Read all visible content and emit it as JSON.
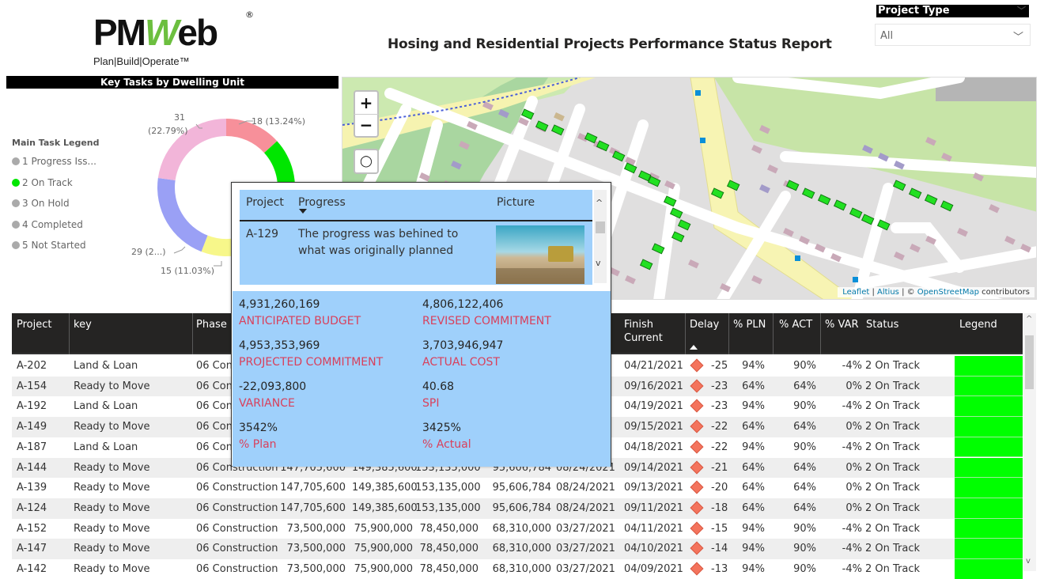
{
  "brand": {
    "logo_text_a": "PM",
    "logo_text_w": "W",
    "logo_text_b": "eb",
    "registered": "®",
    "tagline": "Plan|Build|Operate™"
  },
  "report_title": "Hosing and Residential Projects Performance Status Report",
  "slicer": {
    "label": "Project Type",
    "value": "All",
    "chevron": "chevron-down-icon"
  },
  "donut_panel": {
    "title": "Key Tasks by Dwelling Unit",
    "legend_title": "Main Task Legend",
    "legend": [
      {
        "label": "1 Progress Iss...",
        "color": "#aaaaaa"
      },
      {
        "label": "2 On Track",
        "color": "#00e600"
      },
      {
        "label": "3 On Hold",
        "color": "#aaaaaa"
      },
      {
        "label": "4 Completed",
        "color": "#aaaaaa"
      },
      {
        "label": "5 Not Started",
        "color": "#aaaaaa"
      }
    ]
  },
  "chart_data": {
    "type": "pie",
    "title": "Key Tasks by Dwelling Unit",
    "donut": true,
    "categories": [
      "1 Progress Issues",
      "2 On Track",
      "3 On Hold",
      "4 Completed",
      "5 Not Started"
    ],
    "values": [
      18,
      43,
      15,
      29,
      31
    ],
    "colors": [
      "#f7909a",
      "#00e600",
      "#f7f78a",
      "#9aa0f5",
      "#f2b5d9"
    ],
    "data_labels": [
      "18 (13.24%)",
      "",
      "15 (11.03%)",
      "29 (2...)",
      "31 (22.79%)"
    ],
    "legend_position": "left"
  },
  "map": {
    "zoom_in": "+",
    "zoom_out": "−",
    "lasso_icon": "lasso-icon",
    "attribution": {
      "leaflet": "Leaflet",
      "sep1": " | ",
      "altius": "Altius",
      "sep2": " | © ",
      "osm": "OpenStreetMap",
      "tail": " contributors"
    }
  },
  "tooltip": {
    "columns": [
      "Project",
      "Progress",
      "Picture"
    ],
    "row": {
      "project": "A-129",
      "progress": "The progress was behined to what was originally planned"
    },
    "kpis": [
      {
        "value": "4,931,260,169",
        "label": "ANTICIPATED BUDGET"
      },
      {
        "value": "4,806,122,406",
        "label": "REVISED COMMITMENT"
      },
      {
        "value": "4,953,353,969",
        "label": "PROJECTED COMMITMENT"
      },
      {
        "value": "3,703,946,947",
        "label": "ACTUAL COST"
      },
      {
        "value": "-22,093,800",
        "label": "VARIANCE"
      },
      {
        "value": "40.68",
        "label": "SPI"
      },
      {
        "value": "3542%",
        "label": "% Plan"
      },
      {
        "value": "3425%",
        "label": "% Actual"
      }
    ]
  },
  "table": {
    "columns": [
      "Project",
      "key",
      "Phase",
      "Finish\nCurrent",
      "Delay",
      "% PLN",
      "% ACT",
      "% VAR",
      "Status",
      "Legend"
    ],
    "finish_col": [
      "Finish",
      "Current"
    ],
    "rows": [
      {
        "project": "A-202",
        "key": "Land & Loan",
        "phase": "06 Con",
        "c1": "",
        "c2": "",
        "c3": "",
        "c4": "",
        "start": "",
        "finish": "04/21/2021",
        "delay": "-25",
        "pln": "94%",
        "act": "90%",
        "var": "-4%",
        "status": "2 On Track"
      },
      {
        "project": "A-154",
        "key": "Ready to Move",
        "phase": "06 Con",
        "c1": "",
        "c2": "",
        "c3": "",
        "c4": "",
        "start": "",
        "finish": "09/16/2021",
        "delay": "-23",
        "pln": "64%",
        "act": "64%",
        "var": "0%",
        "status": "2 On Track"
      },
      {
        "project": "A-192",
        "key": "Land & Loan",
        "phase": "06 Con",
        "c1": "",
        "c2": "",
        "c3": "",
        "c4": "",
        "start": "",
        "finish": "04/19/2021",
        "delay": "-23",
        "pln": "94%",
        "act": "90%",
        "var": "-4%",
        "status": "2 On Track"
      },
      {
        "project": "A-149",
        "key": "Ready to Move",
        "phase": "06 Con",
        "c1": "",
        "c2": "",
        "c3": "",
        "c4": "",
        "start": "",
        "finish": "09/15/2021",
        "delay": "-22",
        "pln": "64%",
        "act": "64%",
        "var": "0%",
        "status": "2 On Track"
      },
      {
        "project": "A-187",
        "key": "Land & Loan",
        "phase": "06 Con",
        "c1": "",
        "c2": "",
        "c3": "",
        "c4": "",
        "start": "",
        "finish": "04/18/2021",
        "delay": "-22",
        "pln": "94%",
        "act": "90%",
        "var": "-4%",
        "status": "2 On Track"
      },
      {
        "project": "A-144",
        "key": "Ready to Move",
        "phase": "06 Construction",
        "c1": "147,705,600",
        "c2": "149,385,600",
        "c3": "153,135,000",
        "c4": "95,606,784",
        "start": "08/24/2021",
        "finish": "09/14/2021",
        "delay": "-21",
        "pln": "64%",
        "act": "64%",
        "var": "0%",
        "status": "2 On Track"
      },
      {
        "project": "A-139",
        "key": "Ready to Move",
        "phase": "06 Construction",
        "c1": "147,705,600",
        "c2": "149,385,600",
        "c3": "153,135,000",
        "c4": "95,606,784",
        "start": "08/24/2021",
        "finish": "09/13/2021",
        "delay": "-20",
        "pln": "64%",
        "act": "64%",
        "var": "0%",
        "status": "2 On Track"
      },
      {
        "project": "A-124",
        "key": "Ready to Move",
        "phase": "06 Construction",
        "c1": "147,705,600",
        "c2": "149,385,600",
        "c3": "153,135,000",
        "c4": "95,606,784",
        "start": "08/24/2021",
        "finish": "09/11/2021",
        "delay": "-18",
        "pln": "64%",
        "act": "64%",
        "var": "0%",
        "status": "2 On Track"
      },
      {
        "project": "A-152",
        "key": "Ready to Move",
        "phase": "06 Construction",
        "c1": "73,500,000",
        "c2": "75,900,000",
        "c3": "78,450,000",
        "c4": "68,310,000",
        "start": "03/27/2021",
        "finish": "04/11/2021",
        "delay": "-15",
        "pln": "94%",
        "act": "90%",
        "var": "-4%",
        "status": "2 On Track"
      },
      {
        "project": "A-147",
        "key": "Ready to Move",
        "phase": "06 Construction",
        "c1": "73,500,000",
        "c2": "75,900,000",
        "c3": "78,450,000",
        "c4": "68,310,000",
        "start": "03/27/2021",
        "finish": "04/10/2021",
        "delay": "-14",
        "pln": "94%",
        "act": "90%",
        "var": "-4%",
        "status": "2 On Track"
      },
      {
        "project": "A-142",
        "key": "Ready to Move",
        "phase": "06 Construction",
        "c1": "73,500,000",
        "c2": "75,900,000",
        "c3": "78,450,000",
        "c4": "68,310,000",
        "start": "03/27/2021",
        "finish": "04/09/2021",
        "delay": "-13",
        "pln": "94%",
        "act": "90%",
        "var": "-4%",
        "status": "2 On Track"
      }
    ],
    "legend_color": "#00ff00",
    "delay_icon_color": "#f4735c"
  }
}
